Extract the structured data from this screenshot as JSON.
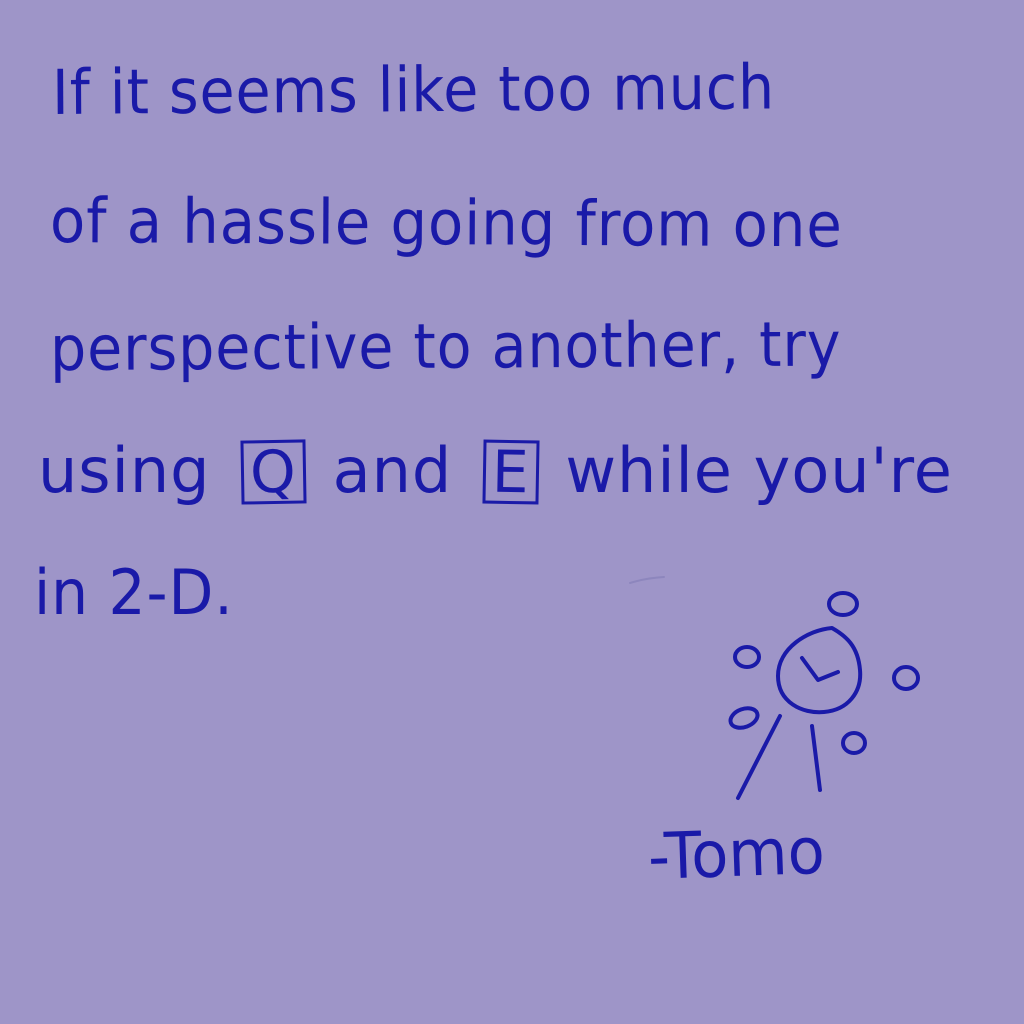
{
  "note": {
    "lines": [
      "If it seems like too much",
      "of a hassle going from one",
      "perspective to another, try"
    ],
    "line4": {
      "before": "using",
      "key_q": "Q",
      "between": "and",
      "key_e": "E",
      "after": "while you're"
    },
    "line5": "in 2-D.",
    "signature": "-Tomo"
  },
  "colors": {
    "background": "#9e95c8",
    "ink": "#1a1aa8"
  },
  "icons": {
    "doodle": "sun-face-doodle-icon"
  }
}
